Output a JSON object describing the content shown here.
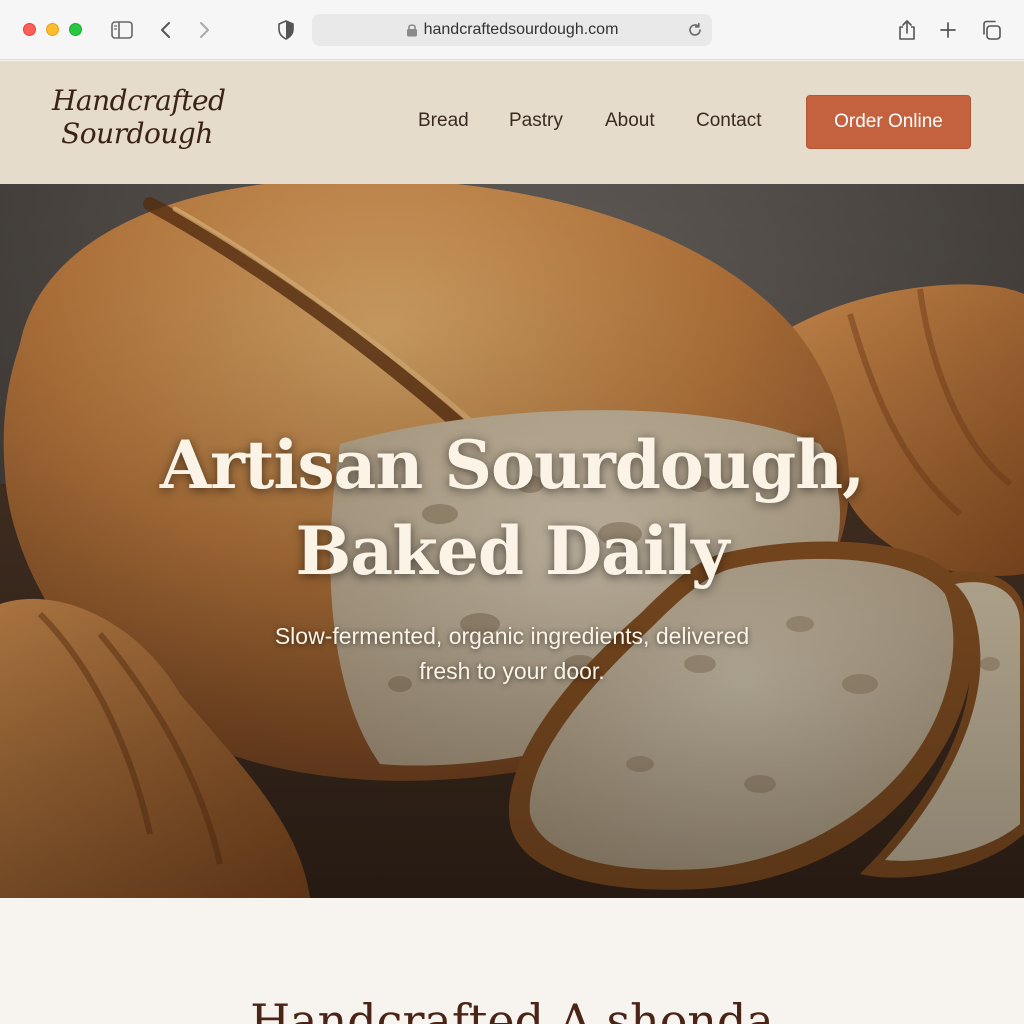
{
  "browser": {
    "url": "handcraftedsourdough.com"
  },
  "header": {
    "logo_line1": "Handcrafted",
    "logo_line2": "Sourdough",
    "nav": [
      "Bread",
      "Pastry",
      "About",
      "Contact"
    ],
    "cta": "Order Online"
  },
  "hero": {
    "title_line1": "Artisan Sourdough,",
    "title_line2": "Baked Daily",
    "subtitle_line1": "Slow-fermented, organic ingredients, delivered",
    "subtitle_line2": "fresh to your door."
  },
  "section": {
    "title": "Handcrafted A shonda"
  },
  "colors": {
    "header_bg": "#e6dccb",
    "cta_bg": "#c4623f",
    "text_dark": "#3a2a1f",
    "hero_text": "#fbf3e6"
  }
}
